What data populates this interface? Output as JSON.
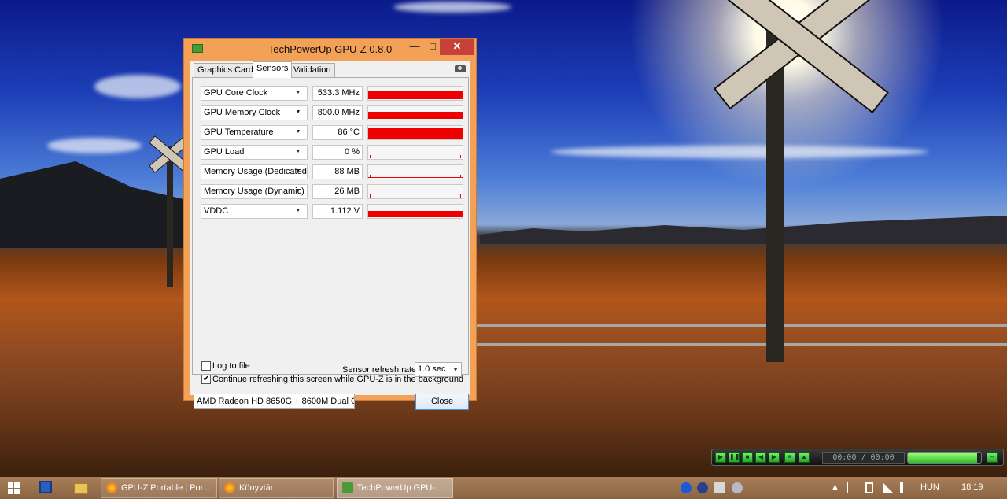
{
  "window": {
    "title": "TechPowerUp GPU-Z 0.8.0",
    "minimize": "—",
    "maximize": "□",
    "close_glyph": "✕"
  },
  "tabs": [
    "Graphics Card",
    "Sensors",
    "Validation"
  ],
  "active_tab": "Sensors",
  "sensors": [
    {
      "name": "GPU Core Clock",
      "value": "533.3 MHz",
      "level": 0.6
    },
    {
      "name": "GPU Memory Clock",
      "value": "800.0 MHz",
      "level": 0.55
    },
    {
      "name": "GPU Temperature",
      "value": "86 °C",
      "level": 0.8
    },
    {
      "name": "GPU Load",
      "value": "0 %",
      "level": 0.0
    },
    {
      "name": "Memory Usage (Dedicated)",
      "value": "88 MB",
      "level": 0.04
    },
    {
      "name": "Memory Usage (Dynamic)",
      "value": "26 MB",
      "level": 0.0
    },
    {
      "name": "VDDC",
      "value": "1.112 V",
      "level": 0.45
    }
  ],
  "options": {
    "log_to_file": "Log to file",
    "log_to_file_checked": false,
    "continue_refresh": "Continue refreshing this screen while GPU-Z is in the background",
    "continue_refresh_checked": true,
    "refresh_rate_label": "Sensor refresh rate:",
    "refresh_rate_value": "1.0 sec"
  },
  "gpu_select": "AMD Radeon HD 8650G + 8600M Dual G",
  "close_button": "Close",
  "taskbar": {
    "tasks": [
      {
        "label": "GPU-Z Portable | Por...",
        "icon": "firefox-icon",
        "active": false
      },
      {
        "label": "Könyvtár",
        "icon": "firefox-icon",
        "active": false
      },
      {
        "label": "TechPowerUp GPU-...",
        "icon": "gpuz-icon",
        "active": true
      }
    ],
    "language": "HUN",
    "clock": "18:19"
  },
  "media_player": {
    "time": "00:00 / 00:00",
    "progress": 0.95
  },
  "colors": {
    "graph": "#ee0000",
    "window_frame": "#f2a157",
    "close_button_bg": "#c7403a",
    "taskbar": "#8a6442"
  }
}
